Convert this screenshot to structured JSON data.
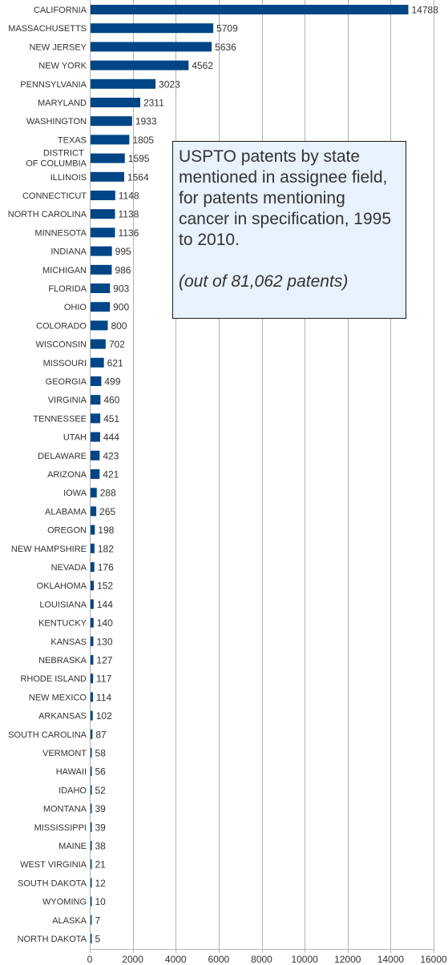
{
  "chart_data": {
    "type": "bar",
    "orientation": "horizontal",
    "title": "",
    "xlabel": "",
    "ylabel": "",
    "xlim": [
      0,
      16000
    ],
    "x_ticks": [
      0,
      2000,
      4000,
      6000,
      8000,
      10000,
      12000,
      14000,
      16000
    ],
    "grid": true,
    "bar_color": "#004586",
    "data_labels": true,
    "categories": [
      "CALIFORNIA",
      "MASSACHUSETTS",
      "NEW JERSEY",
      "NEW YORK",
      "PENNSYLVANIA",
      "MARYLAND",
      "WASHINGTON",
      "TEXAS",
      "DISTRICT OF COLUMBIA",
      "ILLINOIS",
      "CONNECTICUT",
      "NORTH CAROLINA",
      "MINNESOTA",
      "INDIANA",
      "MICHIGAN",
      "FLORIDA",
      "OHIO",
      "COLORADO",
      "WISCONSIN",
      "MISSOURI",
      "GEORGIA",
      "VIRGINIA",
      "TENNESSEE",
      "UTAH",
      "DELAWARE",
      "ARIZONA",
      "IOWA",
      "ALABAMA",
      "OREGON",
      "NEW HAMPSHIRE",
      "NEVADA",
      "OKLAHOMA",
      "LOUISIANA",
      "KENTUCKY",
      "KANSAS",
      "NEBRASKA",
      "RHODE ISLAND",
      "NEW MEXICO",
      "ARKANSAS",
      "SOUTH CAROLINA",
      "VERMONT",
      "HAWAII",
      "IDAHO",
      "MONTANA",
      "MISSISSIPPI",
      "MAINE",
      "WEST VIRGINIA",
      "SOUTH DAKOTA",
      "WYOMING",
      "ALASKA",
      "NORTH DAKOTA"
    ],
    "category_label_lines": {
      "DISTRICT OF COLUMBIA": [
        "DISTRICT",
        "OF COLUMBIA"
      ]
    },
    "values": [
      14788,
      5709,
      5636,
      4562,
      3023,
      2311,
      1933,
      1805,
      1595,
      1564,
      1148,
      1138,
      1136,
      995,
      986,
      903,
      900,
      800,
      702,
      621,
      499,
      460,
      451,
      444,
      423,
      421,
      288,
      265,
      198,
      182,
      176,
      152,
      144,
      140,
      130,
      127,
      117,
      114,
      102,
      87,
      58,
      56,
      52,
      39,
      39,
      38,
      21,
      12,
      10,
      7,
      5
    ],
    "annotation": {
      "title": "USPTO patents by state mentioned in assignee field, for patents mentioning cancer in specification, 1995 to 2010.",
      "note": "(out of 81,062 patents)",
      "position": "upper-middle-right"
    }
  }
}
